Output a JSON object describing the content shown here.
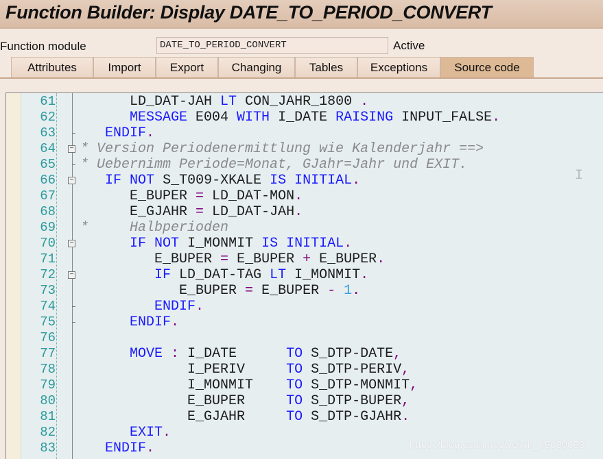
{
  "window": {
    "title": "Function Builder: Display DATE_TO_PERIOD_CONVERT"
  },
  "header": {
    "function_module_label": "Function module",
    "function_module_value": "DATE_TO_PERIOD_CONVERT",
    "status": "Active"
  },
  "tabs": [
    {
      "label": "Attributes",
      "active": false
    },
    {
      "label": "Import",
      "active": false
    },
    {
      "label": "Export",
      "active": false
    },
    {
      "label": "Changing",
      "active": false
    },
    {
      "label": "Tables",
      "active": false
    },
    {
      "label": "Exceptions",
      "active": false
    },
    {
      "label": "Source code",
      "active": true
    }
  ],
  "colors": {
    "keyword": "#1a1aff",
    "operator": "#800080",
    "comment": "#8a8a8a",
    "number": "#3c9ee0",
    "line_number": "#2a9a9a",
    "editor_bg": "#e6eef0",
    "active_tab": "#ddb995"
  },
  "editor": {
    "lines": [
      {
        "n": "61",
        "fold": "",
        "t": [
          [
            "      LD_DAT-JAH ",
            "id"
          ],
          [
            "LT",
            "kw"
          ],
          [
            " CON_JAHR_1800 ",
            "id"
          ],
          [
            ".",
            "op"
          ]
        ]
      },
      {
        "n": "62",
        "fold": "",
        "t": [
          [
            "      ",
            "id"
          ],
          [
            "MESSAGE",
            "kw"
          ],
          [
            " E004 ",
            "id"
          ],
          [
            "WITH",
            "kw"
          ],
          [
            " I_DATE ",
            "id"
          ],
          [
            "RAISING",
            "kw"
          ],
          [
            " INPUT_FALSE",
            "id"
          ],
          [
            ".",
            "op"
          ]
        ]
      },
      {
        "n": "63",
        "fold": "tick",
        "t": [
          [
            "   ",
            "id"
          ],
          [
            "ENDIF",
            "kw"
          ],
          [
            ".",
            "op"
          ]
        ]
      },
      {
        "n": "64",
        "fold": "box",
        "t": [
          [
            "* Version Periodenermittlung wie Kalenderjahr ==>",
            "cm"
          ]
        ]
      },
      {
        "n": "65",
        "fold": "tick",
        "t": [
          [
            "* Uebernimm Periode=Monat, GJahr=Jahr und EXIT.",
            "cm"
          ]
        ]
      },
      {
        "n": "66",
        "fold": "box",
        "t": [
          [
            "   ",
            "id"
          ],
          [
            "IF",
            "kw"
          ],
          [
            " ",
            "id"
          ],
          [
            "NOT",
            "kw"
          ],
          [
            " S_T009-XKALE ",
            "id"
          ],
          [
            "IS",
            "kw"
          ],
          [
            " ",
            "id"
          ],
          [
            "INITIAL",
            "kw"
          ],
          [
            ".",
            "op"
          ]
        ]
      },
      {
        "n": "67",
        "fold": "",
        "t": [
          [
            "      E_BUPER ",
            "id"
          ],
          [
            "=",
            "op"
          ],
          [
            " LD_DAT-MON",
            "id"
          ],
          [
            ".",
            "op"
          ]
        ]
      },
      {
        "n": "68",
        "fold": "",
        "t": [
          [
            "      E_GJAHR ",
            "id"
          ],
          [
            "=",
            "op"
          ],
          [
            " LD_DAT-JAH",
            "id"
          ],
          [
            ".",
            "op"
          ]
        ]
      },
      {
        "n": "69",
        "fold": "",
        "t": [
          [
            "*     Halbperioden",
            "cm"
          ]
        ]
      },
      {
        "n": "70",
        "fold": "box",
        "t": [
          [
            "      ",
            "id"
          ],
          [
            "IF",
            "kw"
          ],
          [
            " ",
            "id"
          ],
          [
            "NOT",
            "kw"
          ],
          [
            " I_MONMIT ",
            "id"
          ],
          [
            "IS",
            "kw"
          ],
          [
            " ",
            "id"
          ],
          [
            "INITIAL",
            "kw"
          ],
          [
            ".",
            "op"
          ]
        ]
      },
      {
        "n": "71",
        "fold": "",
        "t": [
          [
            "         E_BUPER ",
            "id"
          ],
          [
            "=",
            "op"
          ],
          [
            " E_BUPER ",
            "id"
          ],
          [
            "+",
            "op"
          ],
          [
            " E_BUPER",
            "id"
          ],
          [
            ".",
            "op"
          ]
        ]
      },
      {
        "n": "72",
        "fold": "box",
        "t": [
          [
            "         ",
            "id"
          ],
          [
            "IF",
            "kw"
          ],
          [
            " LD_DAT-TAG ",
            "id"
          ],
          [
            "LT",
            "kw"
          ],
          [
            " I_MONMIT",
            "id"
          ],
          [
            ".",
            "op"
          ]
        ]
      },
      {
        "n": "73",
        "fold": "",
        "t": [
          [
            "            E_BUPER ",
            "id"
          ],
          [
            "=",
            "op"
          ],
          [
            " E_BUPER ",
            "id"
          ],
          [
            "-",
            "op"
          ],
          [
            " ",
            "id"
          ],
          [
            "1",
            "num"
          ],
          [
            ".",
            "op"
          ]
        ]
      },
      {
        "n": "74",
        "fold": "tick",
        "t": [
          [
            "         ",
            "id"
          ],
          [
            "ENDIF",
            "kw"
          ],
          [
            ".",
            "op"
          ]
        ]
      },
      {
        "n": "75",
        "fold": "tick",
        "t": [
          [
            "      ",
            "id"
          ],
          [
            "ENDIF",
            "kw"
          ],
          [
            ".",
            "op"
          ]
        ]
      },
      {
        "n": "76",
        "fold": "",
        "t": []
      },
      {
        "n": "77",
        "fold": "",
        "t": [
          [
            "      ",
            "id"
          ],
          [
            "MOVE",
            "kw"
          ],
          [
            " ",
            "id"
          ],
          [
            ":",
            "op"
          ],
          [
            " I_DATE      ",
            "id"
          ],
          [
            "TO",
            "kw"
          ],
          [
            " S_DTP-DATE",
            "id"
          ],
          [
            ",",
            "op"
          ]
        ]
      },
      {
        "n": "78",
        "fold": "",
        "t": [
          [
            "             I_PERIV     ",
            "id"
          ],
          [
            "TO",
            "kw"
          ],
          [
            " S_DTP-PERIV",
            "id"
          ],
          [
            ",",
            "op"
          ]
        ]
      },
      {
        "n": "79",
        "fold": "",
        "t": [
          [
            "             I_MONMIT    ",
            "id"
          ],
          [
            "TO",
            "kw"
          ],
          [
            " S_DTP-MONMIT",
            "id"
          ],
          [
            ",",
            "op"
          ]
        ]
      },
      {
        "n": "80",
        "fold": "",
        "t": [
          [
            "             E_BUPER     ",
            "id"
          ],
          [
            "TO",
            "kw"
          ],
          [
            " S_DTP-BUPER",
            "id"
          ],
          [
            ",",
            "op"
          ]
        ]
      },
      {
        "n": "81",
        "fold": "",
        "t": [
          [
            "             E_GJAHR     ",
            "id"
          ],
          [
            "TO",
            "kw"
          ],
          [
            " S_DTP-GJAHR",
            "id"
          ],
          [
            ".",
            "op"
          ]
        ]
      },
      {
        "n": "82",
        "fold": "",
        "t": [
          [
            "      ",
            "id"
          ],
          [
            "EXIT",
            "kw"
          ],
          [
            ".",
            "op"
          ]
        ]
      },
      {
        "n": "83",
        "fold": "",
        "t": [
          [
            "   ",
            "id"
          ],
          [
            "ENDIF",
            "kw"
          ],
          [
            ".",
            "op"
          ]
        ]
      }
    ]
  },
  "watermark": "https://blog.csdn.net/weixin_45689053"
}
